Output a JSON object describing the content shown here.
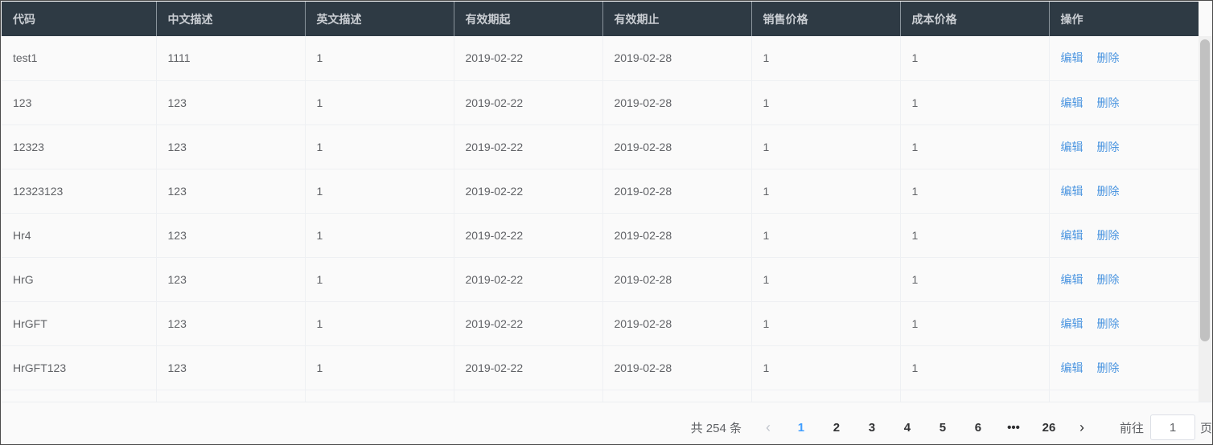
{
  "table": {
    "headers": [
      "代码",
      "中文描述",
      "英文描述",
      "有效期起",
      "有效期止",
      "销售价格",
      "成本价格",
      "操作"
    ],
    "rows": [
      [
        "test1",
        "1111",
        "1",
        "2019-02-22",
        "2019-02-28",
        "1",
        "1"
      ],
      [
        "123",
        "123",
        "1",
        "2019-02-22",
        "2019-02-28",
        "1",
        "1"
      ],
      [
        "12323",
        "123",
        "1",
        "2019-02-22",
        "2019-02-28",
        "1",
        "1"
      ],
      [
        "12323123",
        "123",
        "1",
        "2019-02-22",
        "2019-02-28",
        "1",
        "1"
      ],
      [
        "Hr4",
        "123",
        "1",
        "2019-02-22",
        "2019-02-28",
        "1",
        "1"
      ],
      [
        "HrG",
        "123",
        "1",
        "2019-02-22",
        "2019-02-28",
        "1",
        "1"
      ],
      [
        "HrGFT",
        "123",
        "1",
        "2019-02-22",
        "2019-02-28",
        "1",
        "1"
      ],
      [
        "HrGFT123",
        "123",
        "1",
        "2019-02-22",
        "2019-02-28",
        "1",
        "1"
      ],
      [
        "",
        "",
        "",
        "",
        "",
        "",
        ""
      ]
    ],
    "actions": {
      "edit": "编辑",
      "delete": "删除"
    }
  },
  "pagination": {
    "total_text": "共 254 条",
    "prev_icon": "‹",
    "next_icon": "›",
    "pages": [
      "1",
      "2",
      "3",
      "4",
      "5",
      "6",
      "•••",
      "26"
    ],
    "current_page": "1",
    "jump_prefix": "前往",
    "jump_value": "1",
    "jump_suffix": "页"
  },
  "colors": {
    "header_bg": "#2e3a44",
    "link": "#4b95e0",
    "active_page": "#409eff"
  }
}
